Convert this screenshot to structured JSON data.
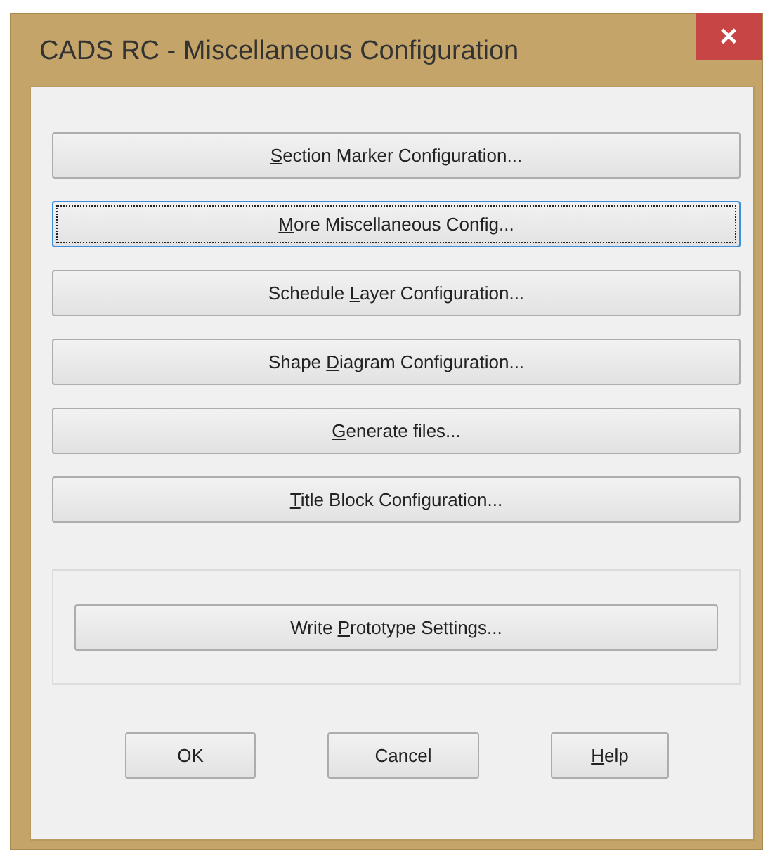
{
  "window": {
    "title": "CADS RC - Miscellaneous Configuration",
    "close_label": "×"
  },
  "config_buttons": [
    {
      "key": "S",
      "after": "ection Marker Configuration...",
      "focused": false
    },
    {
      "key": "M",
      "after": "ore Miscellaneous Config...",
      "focused": true
    },
    {
      "before": "Schedule ",
      "key": "L",
      "after": "ayer Configuration...",
      "focused": false
    },
    {
      "before": "Shape ",
      "key": "D",
      "after": "iagram Configuration...",
      "focused": false
    },
    {
      "key": "G",
      "after": "enerate files...",
      "focused": false
    },
    {
      "key": "T",
      "after": "itle Block Configuration...",
      "focused": false
    }
  ],
  "prototype_button": {
    "before": "Write ",
    "key": "P",
    "after": "rototype Settings...",
    "focused": false
  },
  "dialog_buttons": [
    {
      "before": "OK",
      "focused": false
    },
    {
      "before": "Cancel",
      "focused": false
    },
    {
      "key": "H",
      "after": "elp",
      "focused": false
    }
  ]
}
